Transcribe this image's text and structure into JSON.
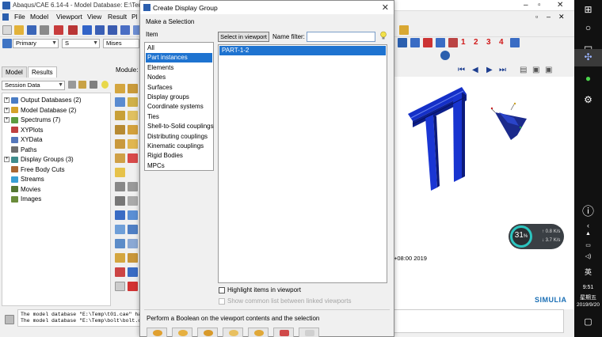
{
  "main": {
    "title": "Abaqus/CAE 6.14-4 - Model Database: E:\\Temp\\",
    "menu": [
      "File",
      "Model",
      "Viewport",
      "View",
      "Result",
      "Pl"
    ],
    "toolbar": {
      "primary_value": "Primary",
      "component_value": "S",
      "invariant_value": "Mises",
      "numbers": [
        "1",
        "2",
        "3",
        "4"
      ]
    },
    "tabs": [
      "Model",
      "Results"
    ],
    "session_combo": "Session Data",
    "module_label": "Module:",
    "tree": [
      {
        "label": "Output Databases (2)",
        "expandable": true,
        "icon_color": "#4a7cc4"
      },
      {
        "label": "Model Database (2)",
        "expandable": true,
        "icon_color": "#d4a22a"
      },
      {
        "label": "Spectrums (7)",
        "expandable": true,
        "icon_color": "#5c9c3f"
      },
      {
        "label": "XYPlots",
        "expandable": false,
        "icon_color": "#c04040"
      },
      {
        "label": "XYData",
        "expandable": false,
        "icon_color": "#5577bb"
      },
      {
        "label": "Paths",
        "expandable": false,
        "icon_color": "#6f6f6f"
      },
      {
        "label": "Display Groups (3)",
        "expandable": true,
        "icon_color": "#3f8c8c"
      },
      {
        "label": "Free Body Cuts",
        "expandable": false,
        "icon_color": "#aa6633"
      },
      {
        "label": "Streams",
        "expandable": false,
        "icon_color": "#3a9fd4"
      },
      {
        "label": "Movies",
        "expandable": false,
        "icon_color": "#557733"
      },
      {
        "label": "Images",
        "expandable": false,
        "icon_color": "#6a8c3a"
      }
    ],
    "messages": [
      "The model database \"E:\\Temp\\t01.cae\" has b",
      "The model database \"E:\\Temp\\bolt\\bolt.cae"
    ],
    "stamp": "+08:00 2019",
    "brand": "SIMULIA"
  },
  "dialog": {
    "title": "Create Display Group",
    "section_label": "Make a Selection",
    "item_label": "Item",
    "items": [
      {
        "label": "All",
        "selected": false
      },
      {
        "label": "Part instances",
        "selected": true
      },
      {
        "label": "Elements",
        "selected": false
      },
      {
        "label": "Nodes",
        "selected": false
      },
      {
        "label": "Surfaces",
        "selected": false
      },
      {
        "label": "Display groups",
        "selected": false
      },
      {
        "label": "Coordinate systems",
        "selected": false
      },
      {
        "label": "Ties",
        "selected": false
      },
      {
        "label": "Shell-to-Solid couplings",
        "selected": false
      },
      {
        "label": "Distributing couplings",
        "selected": false
      },
      {
        "label": "Kinematic couplings",
        "selected": false
      },
      {
        "label": "Rigid Bodies",
        "selected": false
      },
      {
        "label": "MPCs",
        "selected": false
      }
    ],
    "select_button": "Select in viewport",
    "name_filter_label": "Name filter:",
    "name_filter_value": "",
    "parts": [
      "PART-1-2"
    ],
    "highlight_label": "Highlight items in viewport",
    "highlight_checked": false,
    "common_label": "Show common list between linked viewports",
    "boolean_label": "Perform a Boolean on the viewport contents and the selection"
  },
  "perf_widget": {
    "percent": "31",
    "percent_unit": "%",
    "up": "0.8",
    "down": "3.7",
    "unit": "K/s"
  },
  "winbar": {
    "lang": "英",
    "time": "9:51",
    "weekday": "星期五",
    "date": "2019/9/20"
  },
  "colors": {
    "selection": "#1e73d0",
    "accent": "#2b5fae",
    "model_blue": "#1530c8",
    "taskbar": "#111111"
  }
}
